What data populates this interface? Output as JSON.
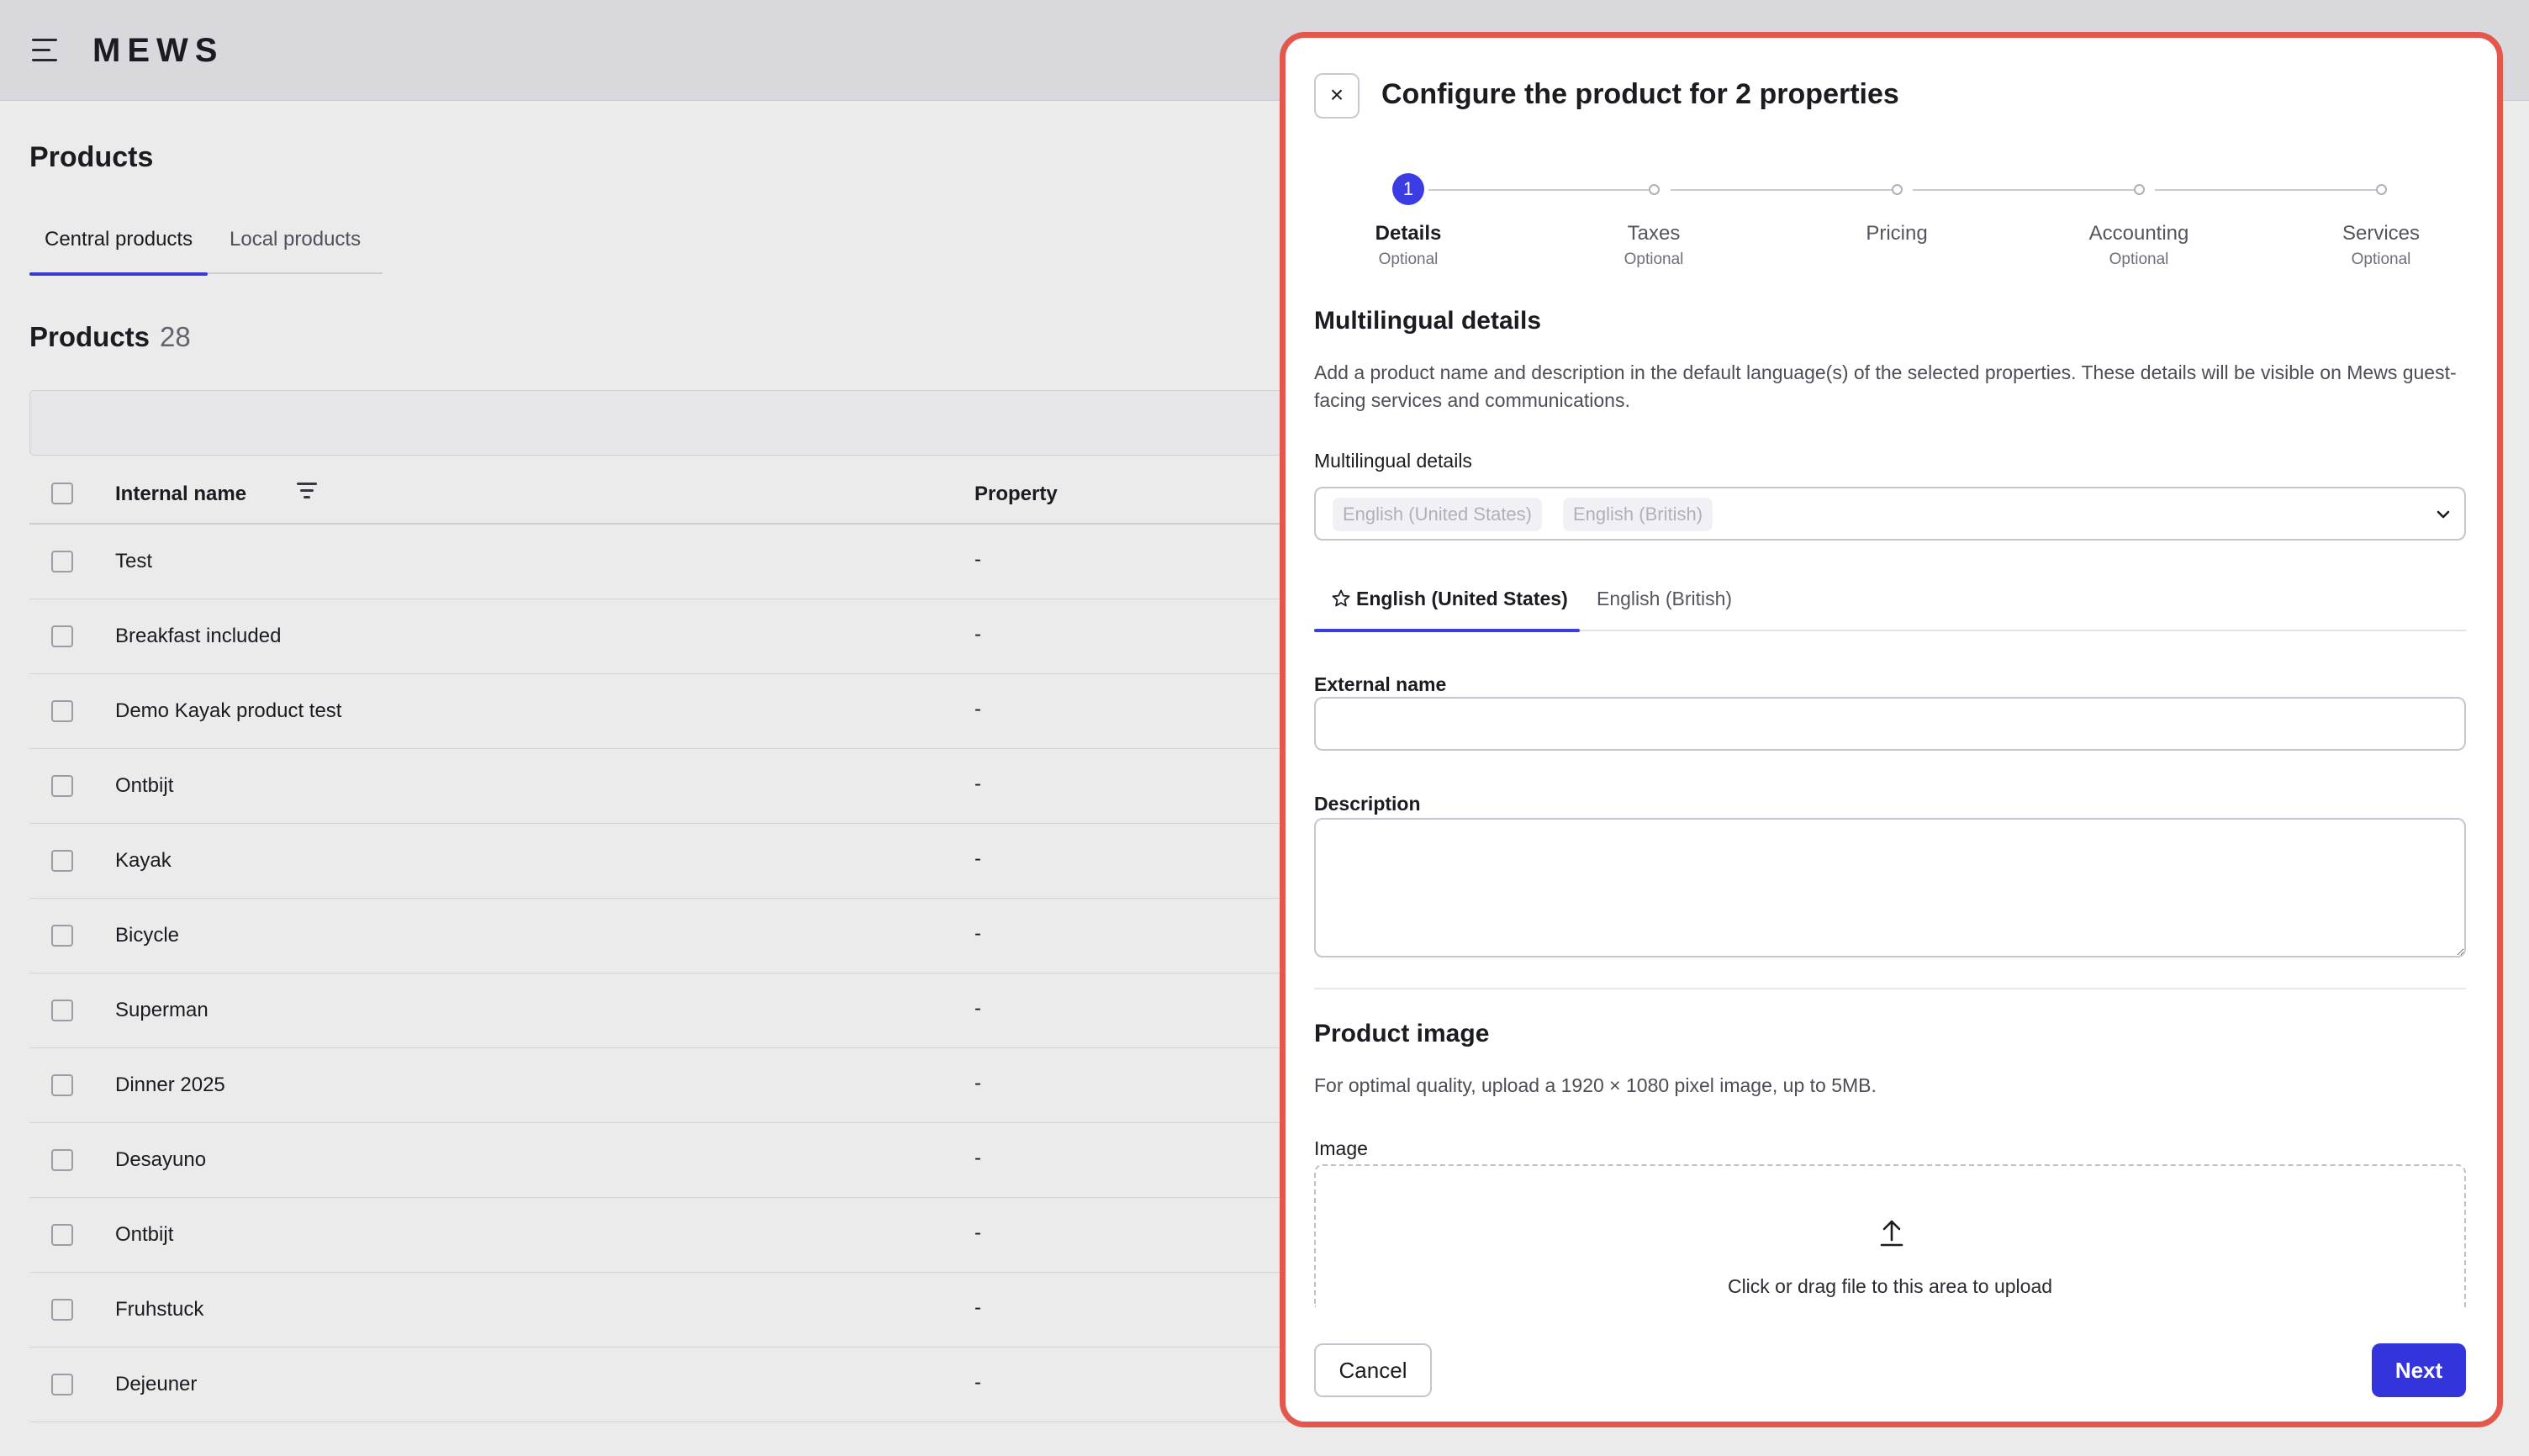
{
  "app": {
    "logo": "MEWS"
  },
  "page": {
    "title": "Products",
    "tabs": [
      {
        "label": "Central products"
      },
      {
        "label": "Local products"
      }
    ],
    "section": {
      "title": "Products",
      "count": "28"
    },
    "table": {
      "columns": {
        "name": "Internal name",
        "property": "Property"
      },
      "rows": [
        {
          "name": "Test",
          "property": "-"
        },
        {
          "name": "Breakfast included",
          "property": "-"
        },
        {
          "name": "Demo Kayak product test",
          "property": "-"
        },
        {
          "name": "Ontbijt",
          "property": "-"
        },
        {
          "name": "Kayak",
          "property": "-"
        },
        {
          "name": "Bicycle",
          "property": "-"
        },
        {
          "name": "Superman",
          "property": "-"
        },
        {
          "name": "Dinner 2025",
          "property": "-"
        },
        {
          "name": "Desayuno",
          "property": "-"
        },
        {
          "name": "Ontbijt",
          "property": "-"
        },
        {
          "name": "Fruhstuck",
          "property": "-"
        },
        {
          "name": "Dejeuner",
          "property": "-"
        }
      ]
    }
  },
  "modal": {
    "close_glyph": "×",
    "title": "Configure the product for 2 properties",
    "steps": [
      {
        "number": "1",
        "label": "Details",
        "sub": "Optional"
      },
      {
        "label": "Taxes",
        "sub": "Optional"
      },
      {
        "label": "Pricing",
        "sub": ""
      },
      {
        "label": "Accounting",
        "sub": "Optional"
      },
      {
        "label": "Services",
        "sub": "Optional"
      }
    ],
    "multilingual": {
      "heading": "Multilingual details",
      "description": "Add a product name and description in the default language(s) of the selected properties. These details will be visible on Mews guest-facing services and communications.",
      "field_label": "Multilingual details",
      "chips": [
        "English (United States)",
        "English (British)"
      ],
      "lang_tabs": [
        "English (United States)",
        "English (British)"
      ]
    },
    "external_name": {
      "label": "External name",
      "value": ""
    },
    "description": {
      "label": "Description",
      "value": ""
    },
    "product_image": {
      "heading": "Product image",
      "hint": "For optimal quality, upload a 1920 × 1080 pixel image, up to 5MB.",
      "label": "Image",
      "upload_text": "Click or drag file to this area to upload"
    },
    "footer": {
      "cancel": "Cancel",
      "next": "Next"
    },
    "accent_color": "#3c3ce4",
    "highlight_color": "#e4574c"
  }
}
